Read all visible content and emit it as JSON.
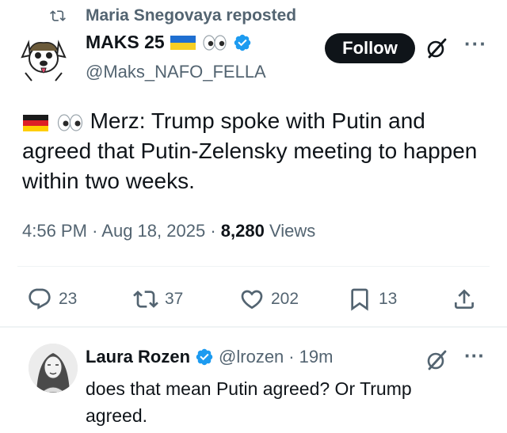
{
  "repost": {
    "text": "Maria Snegovaya reposted"
  },
  "author": {
    "name": "MAKS 25",
    "handle": "@Maks_NAFO_FELLA",
    "follow_label": "Follow"
  },
  "tweet": {
    "text": "Merz: Trump spoke with Putin and agreed that Putin-Zelensky meeting to happen within two weeks.",
    "time": "4:56 PM",
    "date": "Aug 18, 2025",
    "views_count": "8,280",
    "views_label": "Views"
  },
  "actions": {
    "replies": "23",
    "reposts": "37",
    "likes": "202",
    "bookmarks": "13"
  },
  "reply": {
    "name": "Laura Rozen",
    "handle": "@lrozen",
    "time": "19m",
    "text": "does that mean Putin agreed? Or Trump agreed."
  },
  "colors": {
    "text": "#0f1419",
    "muted": "#536471",
    "verified": "#1d9bf0",
    "follow_bg": "#0f1419",
    "divider": "#eff3f4"
  },
  "icons": [
    "repost-icon",
    "verified-badge-icon",
    "grok-icon",
    "more-icon",
    "reply-icon",
    "like-icon",
    "bookmark-icon",
    "share-icon"
  ]
}
